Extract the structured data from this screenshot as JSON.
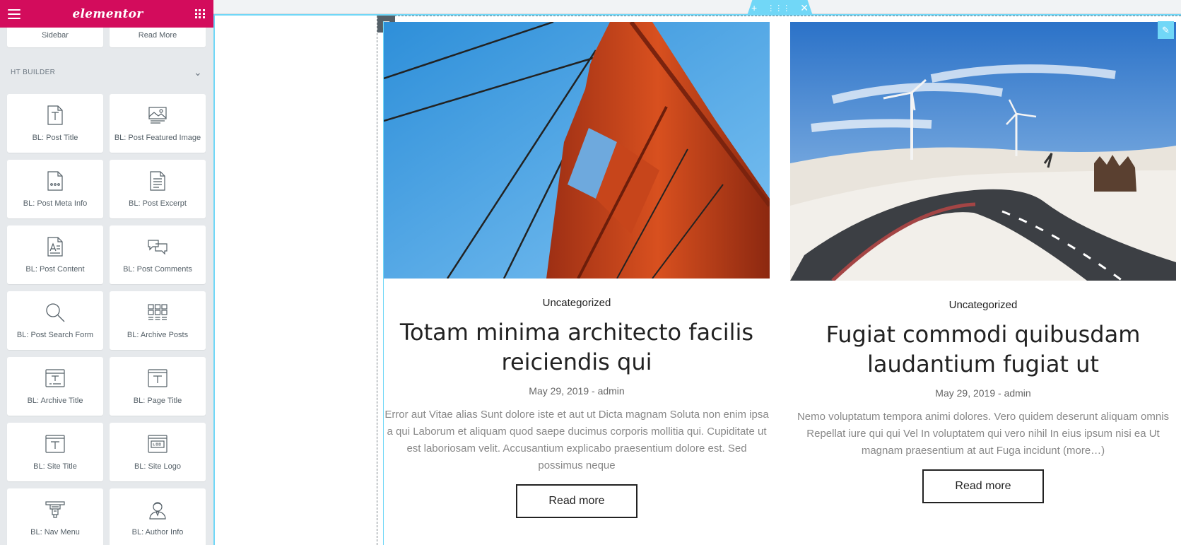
{
  "app": {
    "logo": "elementor"
  },
  "panel": {
    "top_tiles": [
      "Sidebar",
      "Read More"
    ],
    "section_title": "HT BUILDER",
    "widgets": [
      "BL: Post Title",
      "BL: Post Featured Image",
      "BL: Post Meta Info",
      "BL: Post Excerpt",
      "BL: Post Content",
      "BL: Post Comments",
      "BL: Post Search Form",
      "BL: Archive Posts",
      "BL: Archive Title",
      "BL: Page Title",
      "BL: Site Title",
      "BL: Site Logo",
      "BL: Nav Menu",
      "BL: Author Info"
    ]
  },
  "posts": [
    {
      "category": "Uncategorized",
      "title": "Totam minima architecto facilis reiciendis qui",
      "meta": "May 29, 2019 - admin",
      "excerpt": "Error aut Vitae alias Sunt dolore iste et aut ut Dicta magnam Soluta non enim ipsa a qui Laborum et aliquam quod saepe ducimus corporis mollitia qui. Cupiditate ut est laboriosam velit. Accusantium explicabo praesentium dolore est. Sed possimus neque",
      "button": "Read more"
    },
    {
      "category": "Uncategorized",
      "title": "Fugiat commodi quibusdam laudantium fugiat ut",
      "meta": "May 29, 2019 - admin",
      "excerpt": "Nemo voluptatum tempora animi dolores. Vero quidem deserunt aliquam omnis Repellat iure qui qui Vel In voluptatem qui vero nihil In eius ipsum nisi ea Ut magnam praesentium at aut Fuga incidunt (more…)",
      "button": "Read more"
    }
  ],
  "colors": {
    "brand": "#d30c5c",
    "outline": "#71d7f7",
    "panel_bg": "#e6e9ec"
  }
}
